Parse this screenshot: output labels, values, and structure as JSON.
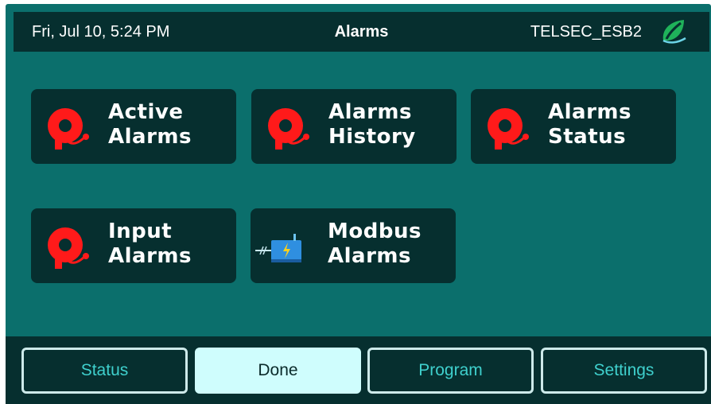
{
  "header": {
    "datetime": "Fri, Jul 10, 5:24 PM",
    "title": "Alarms",
    "device_name": "TELSEC_ESB2",
    "logo_icon": "leaf-logo-icon"
  },
  "tiles": [
    {
      "line1": "Active",
      "line2": "Alarms",
      "icon": "alarm-bell-icon"
    },
    {
      "line1": "Alarms",
      "line2": "History",
      "icon": "alarm-bell-icon"
    },
    {
      "line1": "Alarms",
      "line2": "Status",
      "icon": "alarm-bell-icon"
    },
    {
      "line1": "Input",
      "line2": "Alarms",
      "icon": "alarm-bell-icon"
    },
    {
      "line1": "Modbus",
      "line2": "Alarms",
      "icon": "modbus-device-icon"
    }
  ],
  "footer": {
    "buttons": [
      {
        "label": "Status"
      },
      {
        "label": "Done",
        "active": true
      },
      {
        "label": "Program"
      },
      {
        "label": "Settings"
      }
    ]
  },
  "colors": {
    "background": "#0b6f6c",
    "panel": "#062f2f",
    "bell": "#ff1a1a",
    "button_text": "#3fd0cd",
    "active_button": "#cffdfd"
  }
}
